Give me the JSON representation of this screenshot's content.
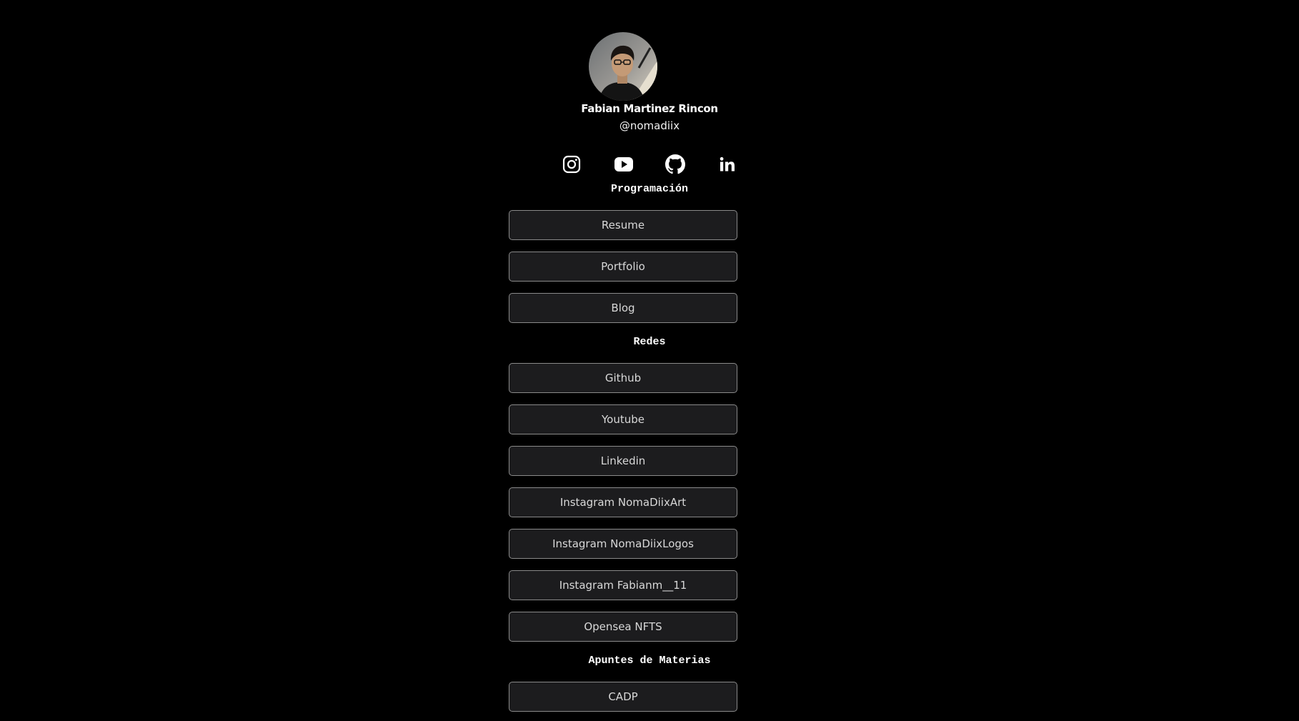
{
  "profile": {
    "name": "Fabian Martinez Rincon",
    "handle": "@nomadiix"
  },
  "social_icons": [
    "instagram-icon",
    "youtube-icon",
    "github-icon",
    "linkedin-icon"
  ],
  "sections": {
    "programacion": {
      "title": "Programación",
      "links": [
        "Resume",
        "Portfolio",
        "Blog"
      ]
    },
    "redes": {
      "title": "Redes",
      "links": [
        "Github",
        "Youtube",
        "Linkedin",
        "Instagram NomaDiixArt",
        "Instagram NomaDiixLogos",
        "Instagram Fabianm__11",
        "Opensea NFTS"
      ]
    },
    "apuntes": {
      "title": "Apuntes de Materias",
      "links": [
        "CADP"
      ]
    }
  },
  "colors": {
    "background": "#000000",
    "button_bg": "#1c1c1e",
    "button_border": "#8a8a8a",
    "text": "#ffffff"
  }
}
